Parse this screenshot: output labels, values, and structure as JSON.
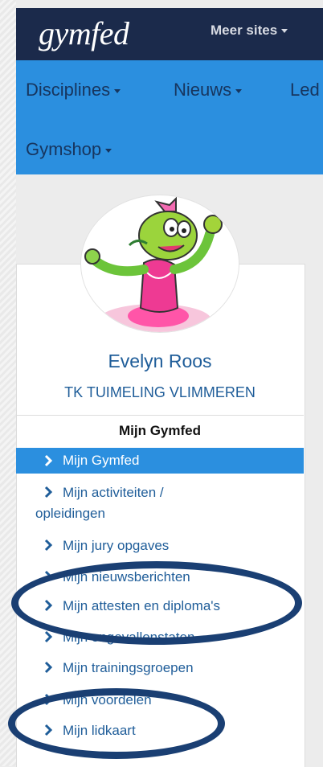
{
  "header": {
    "logo_text": "gymfed",
    "meer_sites_label": "Meer sites"
  },
  "nav": {
    "items": [
      "Disciplines",
      "Nieuws",
      "Led",
      "Gymshop"
    ]
  },
  "profile": {
    "name": "Evelyn Roos",
    "club": "TK TUIMELING VLIMMEREN",
    "avatar_icon": "turtle-gymnast-mascot"
  },
  "menu": {
    "title": "Mijn Gymfed",
    "items": [
      {
        "label": "Mijn Gymfed",
        "active": true
      },
      {
        "label": "Mijn activiteiten /",
        "label2": "opleidingen"
      },
      {
        "label": "Mijn jury opgaves"
      },
      {
        "label": "Mijn nieuwsberichten"
      },
      {
        "label": "Mijn attesten en diploma's"
      },
      {
        "label": "Mijn ongevallenstaten"
      },
      {
        "label": "Mijn trainingsgroepen"
      },
      {
        "label": "Mijn voordelen"
      },
      {
        "label": "Mijn lidkaart"
      }
    ]
  },
  "colors": {
    "header_bg": "#1b2a4b",
    "nav_bg": "#2b8fdf",
    "link": "#1f5d99",
    "annotation": "#1a3f73"
  }
}
